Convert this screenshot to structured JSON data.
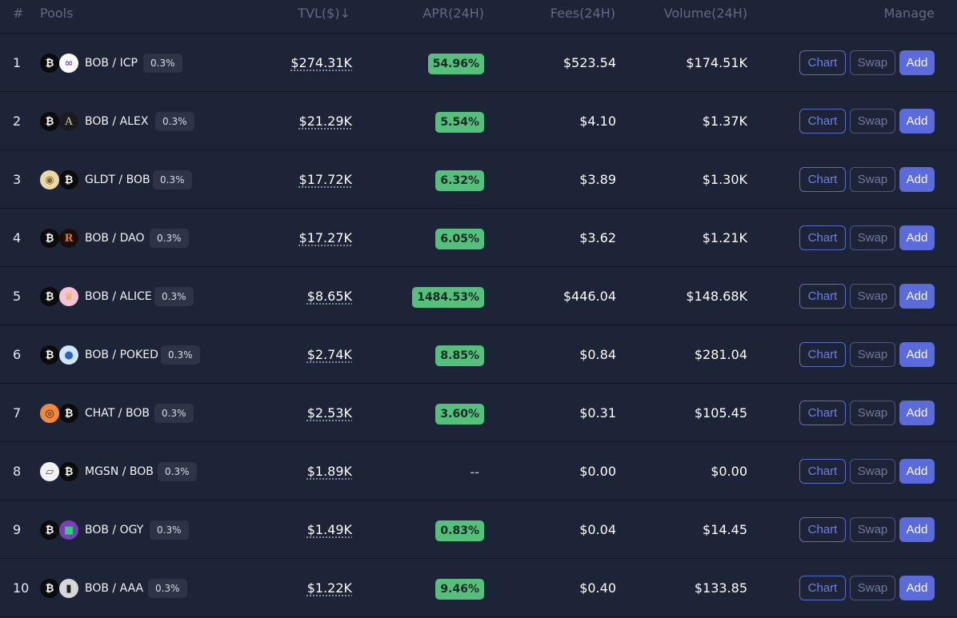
{
  "header": {
    "index": "#",
    "pools": "Pools",
    "tvl": "TVL($)",
    "sort_icon": "↓",
    "apr": "APR(24H)",
    "fees": "Fees(24H)",
    "volume": "Volume(24H)",
    "manage": "Manage"
  },
  "buttons": {
    "chart": "Chart",
    "swap": "Swap",
    "add": "Add"
  },
  "colors": {
    "background": "#1e2438",
    "apr_badge": "#54c07c",
    "add_button": "#5b6bd9",
    "chart_border": "#5b6bc9"
  },
  "rows": [
    {
      "num": "1",
      "pair": "BOB / ICP",
      "fee": "0.3%",
      "tvl": "$274.31K",
      "apr": "54.96%",
      "fees": "$523.54",
      "volume": "$174.51K",
      "icon_a": {
        "name": "bob-token-icon",
        "glyph": "₿"
      },
      "icon_b": {
        "name": "icp-token-icon",
        "glyph": "∞"
      }
    },
    {
      "num": "2",
      "pair": "BOB / ALEX",
      "fee": "0.3%",
      "tvl": "$21.29K",
      "apr": "5.54%",
      "fees": "$4.10",
      "volume": "$1.37K",
      "icon_a": {
        "name": "bob-token-icon",
        "glyph": "₿"
      },
      "icon_b": {
        "name": "alex-token-icon",
        "glyph": "A"
      }
    },
    {
      "num": "3",
      "pair": "GLDT / BOB",
      "fee": "0.3%",
      "tvl": "$17.72K",
      "apr": "6.32%",
      "fees": "$3.89",
      "volume": "$1.30K",
      "icon_a": {
        "name": "gldt-token-icon",
        "glyph": "◉"
      },
      "icon_b": {
        "name": "bob-token-icon",
        "glyph": "₿"
      }
    },
    {
      "num": "4",
      "pair": "BOB / DAO",
      "fee": "0.3%",
      "tvl": "$17.27K",
      "apr": "6.05%",
      "fees": "$3.62",
      "volume": "$1.21K",
      "icon_a": {
        "name": "bob-token-icon",
        "glyph": "₿"
      },
      "icon_b": {
        "name": "dao-token-icon",
        "glyph": "R"
      }
    },
    {
      "num": "5",
      "pair": "BOB / ALICE",
      "fee": "0.3%",
      "tvl": "$8.65K",
      "apr": "1484.53%",
      "fees": "$446.04",
      "volume": "$148.68K",
      "icon_a": {
        "name": "bob-token-icon",
        "glyph": "₿"
      },
      "icon_b": {
        "name": "alice-token-icon",
        "glyph": "♛"
      }
    },
    {
      "num": "6",
      "pair": "BOB / POKED",
      "fee": "0.3%",
      "tvl": "$2.74K",
      "apr": "8.85%",
      "fees": "$0.84",
      "volume": "$281.04",
      "icon_a": {
        "name": "bob-token-icon",
        "glyph": "₿"
      },
      "icon_b": {
        "name": "poked-token-icon",
        "glyph": "●"
      }
    },
    {
      "num": "7",
      "pair": "CHAT / BOB",
      "fee": "0.3%",
      "tvl": "$2.53K",
      "apr": "3.60%",
      "fees": "$0.31",
      "volume": "$105.45",
      "icon_a": {
        "name": "chat-token-icon",
        "glyph": "◎"
      },
      "icon_b": {
        "name": "bob-token-icon",
        "glyph": "₿"
      }
    },
    {
      "num": "8",
      "pair": "MGSN / BOB",
      "fee": "0.3%",
      "tvl": "$1.89K",
      "apr": "--",
      "fees": "$0.00",
      "volume": "$0.00",
      "icon_a": {
        "name": "mgsn-token-icon",
        "glyph": "▱"
      },
      "icon_b": {
        "name": "bob-token-icon",
        "glyph": "₿"
      }
    },
    {
      "num": "9",
      "pair": "BOB / OGY",
      "fee": "0.3%",
      "tvl": "$1.49K",
      "apr": "0.83%",
      "fees": "$0.04",
      "volume": "$14.45",
      "icon_a": {
        "name": "bob-token-icon",
        "glyph": "₿"
      },
      "icon_b": {
        "name": "ogy-token-icon",
        "glyph": "■"
      }
    },
    {
      "num": "10",
      "pair": "BOB / AAA",
      "fee": "0.3%",
      "tvl": "$1.22K",
      "apr": "9.46%",
      "fees": "$0.40",
      "volume": "$133.85",
      "icon_a": {
        "name": "bob-token-icon",
        "glyph": "₿"
      },
      "icon_b": {
        "name": "aaa-token-icon",
        "glyph": "▮"
      }
    }
  ]
}
